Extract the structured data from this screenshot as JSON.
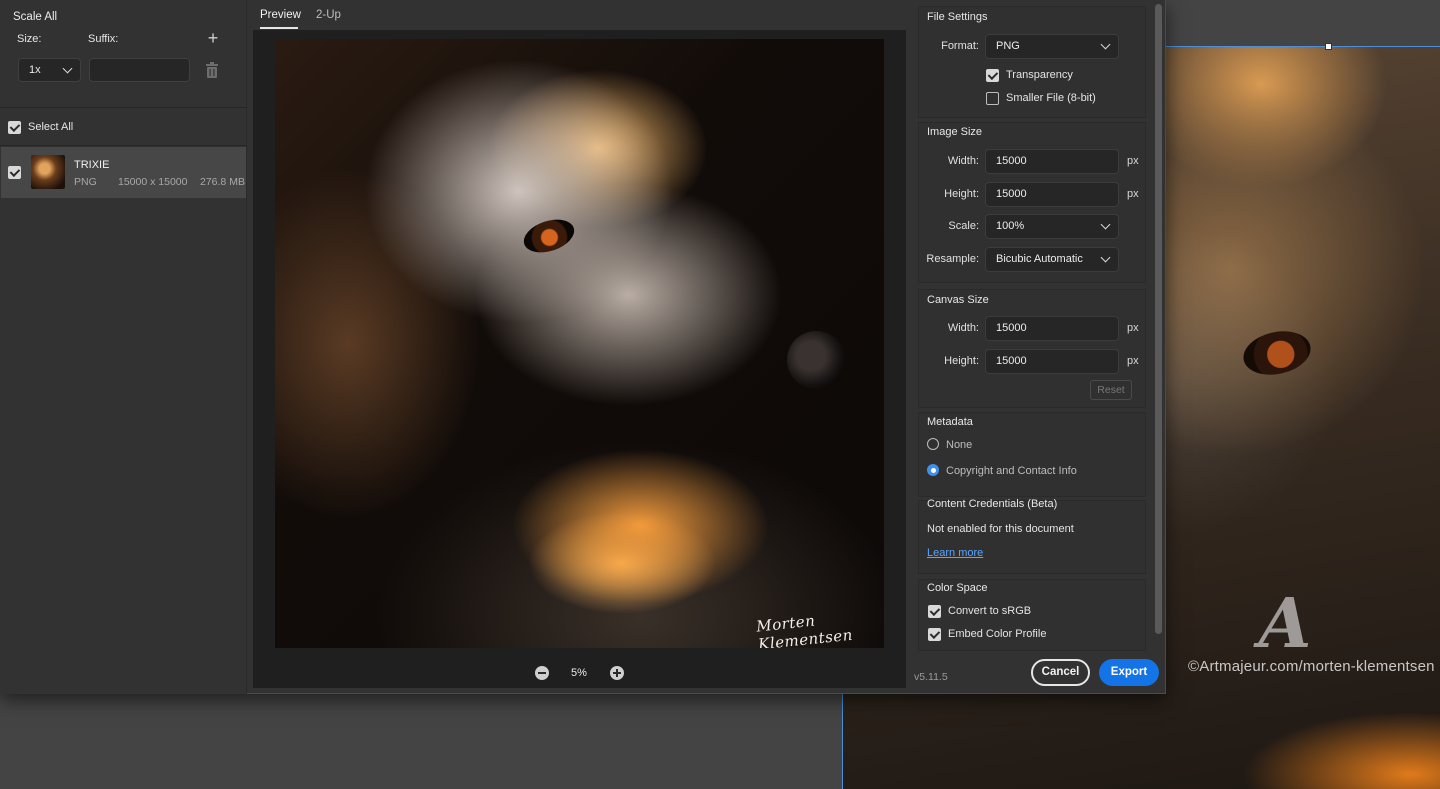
{
  "left": {
    "title": "Scale All",
    "size_label": "Size:",
    "suffix_label": "Suffix:",
    "scale_value": "1x",
    "suffix_value": "",
    "select_all_label": "Select All",
    "asset": {
      "name": "TRIXIE",
      "format": "PNG",
      "dimensions": "15000 x 15000",
      "filesize": "276.8 MB",
      "checked": true
    }
  },
  "preview": {
    "tabs": [
      "Preview",
      "2-Up"
    ],
    "active_tab": "Preview",
    "zoom": "5%"
  },
  "settings": {
    "file_settings": {
      "title": "File Settings",
      "format_label": "Format:",
      "format_value": "PNG",
      "transparency_label": "Transparency",
      "transparency_checked": true,
      "smaller_file_label": "Smaller File (8-bit)",
      "smaller_file_checked": false
    },
    "image_size": {
      "title": "Image Size",
      "width_label": "Width:",
      "width_value": "15000",
      "height_label": "Height:",
      "height_value": "15000",
      "scale_label": "Scale:",
      "scale_value": "100%",
      "resample_label": "Resample:",
      "resample_value": "Bicubic Automatic",
      "unit": "px"
    },
    "canvas_size": {
      "title": "Canvas Size",
      "width_label": "Width:",
      "width_value": "15000",
      "height_label": "Height:",
      "height_value": "15000",
      "unit": "px",
      "reset_label": "Reset"
    },
    "metadata": {
      "title": "Metadata",
      "options": [
        "None",
        "Copyright and Contact Info"
      ],
      "selected": "Copyright and Contact Info"
    },
    "content_credentials": {
      "title": "Content Credentials (Beta)",
      "status": "Not enabled for this document",
      "link": "Learn more"
    },
    "color_space": {
      "title": "Color Space",
      "convert_label": "Convert to sRGB",
      "convert_checked": true,
      "embed_label": "Embed Color Profile",
      "embed_checked": true
    }
  },
  "footer": {
    "version": "v5.11.5",
    "cancel_label": "Cancel",
    "export_label": "Export"
  },
  "artwork": {
    "signature": "Morten Klementsen"
  },
  "background": {
    "watermark_logo": "A",
    "watermark_text": "©Artmajeur.com/morten-klementsen"
  },
  "colors": {
    "accent": "#1473e6",
    "link": "#5aa5ff",
    "radio_selected": "#3d8ff0"
  }
}
